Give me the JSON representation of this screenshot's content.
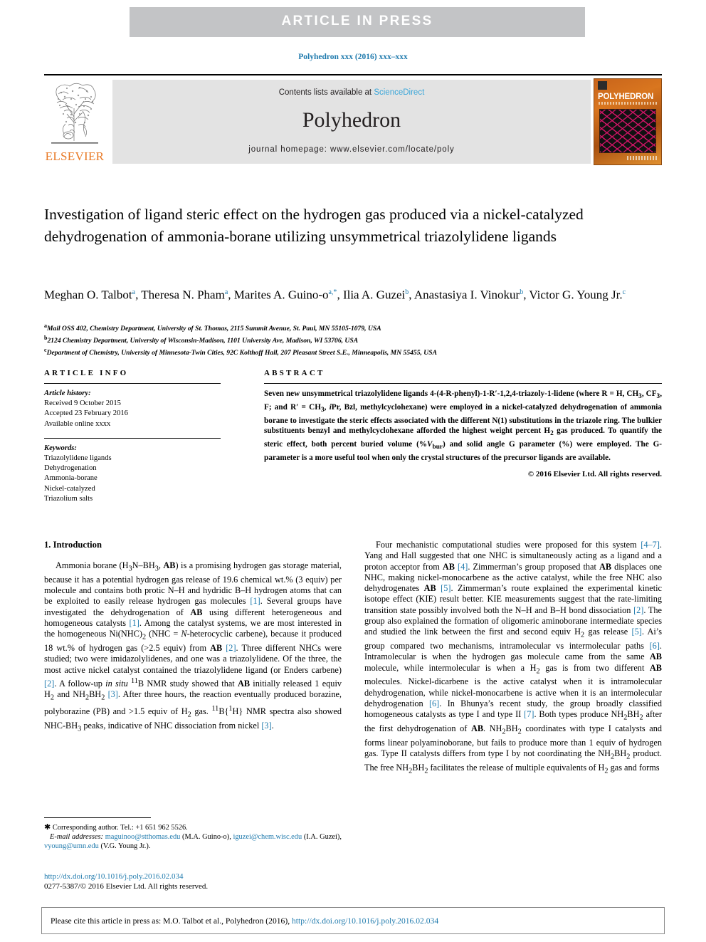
{
  "banner": {
    "label": "ARTICLE  IN  PRESS"
  },
  "running_head": "Polyhedron xxx (2016) xxx–xxx",
  "masthead": {
    "publisher": "ELSEVIER",
    "contents_prefix": "Contents lists available at ",
    "contents_link": "ScienceDirect",
    "journal_name": "Polyhedron",
    "homepage": "journal homepage: www.elsevier.com/locate/poly",
    "cover_title": "POLYHEDRON"
  },
  "article": {
    "title": "Investigation of ligand steric effect on the hydrogen gas produced via a nickel-catalyzed dehydrogenation of ammonia-borane utilizing unsymmetrical triazolylidene ligands",
    "authors": [
      {
        "name": "Meghan O. Talbot",
        "marks": "a"
      },
      {
        "name": "Theresa N. Pham",
        "marks": "a"
      },
      {
        "name": "Marites A. Guino-o",
        "marks": "a,*"
      },
      {
        "name": "Ilia A. Guzei",
        "marks": "b"
      },
      {
        "name": "Anastasiya I. Vinokur",
        "marks": "b"
      },
      {
        "name": "Victor G. Young Jr.",
        "marks": "c"
      }
    ],
    "affiliations": [
      {
        "mark": "a",
        "text": "Mail OSS 402, Chemistry Department, University of St. Thomas, 2115 Summit Avenue, St. Paul, MN 55105-1079, USA"
      },
      {
        "mark": "b",
        "text": "2124 Chemistry Department, University of Wisconsin-Madison, 1101 University Ave, Madison, WI 53706, USA"
      },
      {
        "mark": "c",
        "text": "Department of Chemistry, University of Minnesota-Twin Cities, 92C Kolthoff Hall, 207 Pleasant Street S.E., Minneapolis, MN 55455, USA"
      }
    ]
  },
  "article_info": {
    "heading": "ARTICLE INFO",
    "history_label": "Article history:",
    "history": [
      "Received 9 October 2015",
      "Accepted 23 February 2016",
      "Available online xxxx"
    ],
    "keywords_label": "Keywords:",
    "keywords": [
      "Triazolylidene ligands",
      "Dehydrogenation",
      "Ammonia-borane",
      "Nickel-catalyzed",
      "Triazolium salts"
    ]
  },
  "abstract": {
    "heading": "ABSTRACT",
    "copyright": "© 2016 Elsevier Ltd. All rights reserved."
  },
  "introduction": {
    "heading": "1. Introduction"
  },
  "footnote": {
    "corresponding": "Corresponding author. Tel.: +1 651 962 5526.",
    "emails_label": "E-mail addresses:",
    "emails": [
      {
        "address": "maguinoo@stthomas.edu",
        "owner": "(M.A. Guino-o)"
      },
      {
        "address": "iguzei@chem.wisc.edu",
        "owner": "(I.A. Guzei)"
      },
      {
        "address": "vyoung@umn.edu",
        "owner": "(V.G. Young Jr.)"
      }
    ],
    "doi_url": "http://dx.doi.org/10.1016/j.poly.2016.02.034",
    "issn_line": "0277-5387/© 2016 Elsevier Ltd. All rights reserved."
  },
  "cite_footer": {
    "prefix": "Please cite this article in press as: M.O. Talbot et al., Polyhedron (2016), ",
    "link": "http://dx.doi.org/10.1016/j.poly.2016.02.034"
  },
  "colors": {
    "banner_bg": "#c3c4c6",
    "link_blue": "#1f7aad",
    "sciencedirect_blue": "#3aa6d9",
    "elsevier_orange": "#e87722",
    "band_gray": "#e3e3e3"
  }
}
